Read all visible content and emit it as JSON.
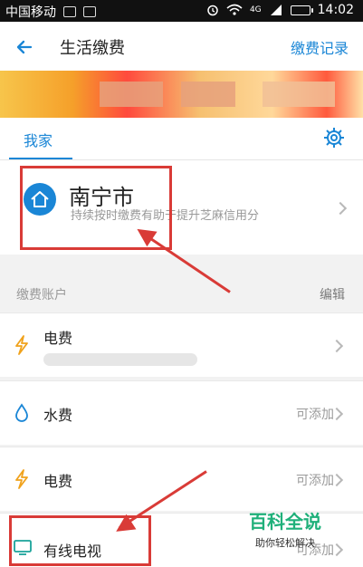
{
  "status_bar": {
    "carrier": "中国移动",
    "network": "4G",
    "time": "14:02"
  },
  "header": {
    "title": "生活缴费",
    "records_link": "缴费记录"
  },
  "tabs": {
    "active": "我家"
  },
  "home": {
    "city": "南宁市",
    "description": "持续按时缴费有助于提升芝麻信用分"
  },
  "accounts": {
    "section_title": "缴费账户",
    "edit_label": "编辑",
    "rows": [
      {
        "label": "电费",
        "right_text": ""
      },
      {
        "label": "水费",
        "right_text": "可添加"
      },
      {
        "label": "电费",
        "right_text": "可添加"
      },
      {
        "label": "有线电视",
        "right_text": "可添加"
      }
    ]
  },
  "watermark": {
    "title": "百科全说",
    "subtitle": "助你轻松解决"
  },
  "colors": {
    "accent": "#1a86d6",
    "annotation_red": "#d93b37",
    "watermark_green": "#1fb07a"
  }
}
